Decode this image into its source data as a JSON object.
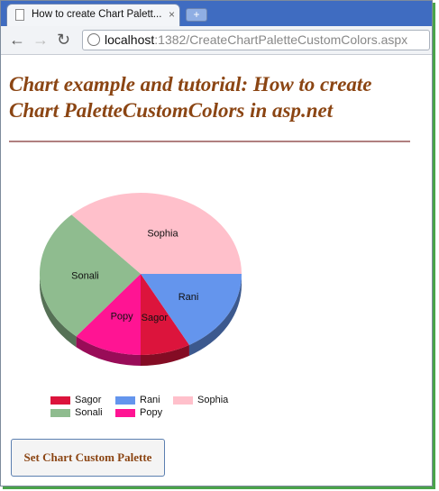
{
  "browser": {
    "tab_title": "How to create Chart Palett...",
    "close_glyph": "×",
    "new_tab_glyph": "+",
    "url_host": "localhost",
    "url_rest": ":1382/CreateChartPaletteCustomColors.aspx"
  },
  "page": {
    "heading": "Chart example and tutorial: How to create Chart PaletteCustomColors in asp.net",
    "button_label": "Set Chart Custom Palette"
  },
  "chart_data": {
    "type": "pie",
    "three_d": true,
    "labels": [
      "Sagor",
      "Rani",
      "Sophia",
      "Sonali",
      "Popy"
    ],
    "values": [
      8,
      17,
      37,
      27,
      11
    ],
    "colors": [
      "#dc143c",
      "#6495ed",
      "#ffc0cb",
      "#8fbc8f",
      "#ff1493"
    ],
    "legend_position": "bottom-left"
  }
}
